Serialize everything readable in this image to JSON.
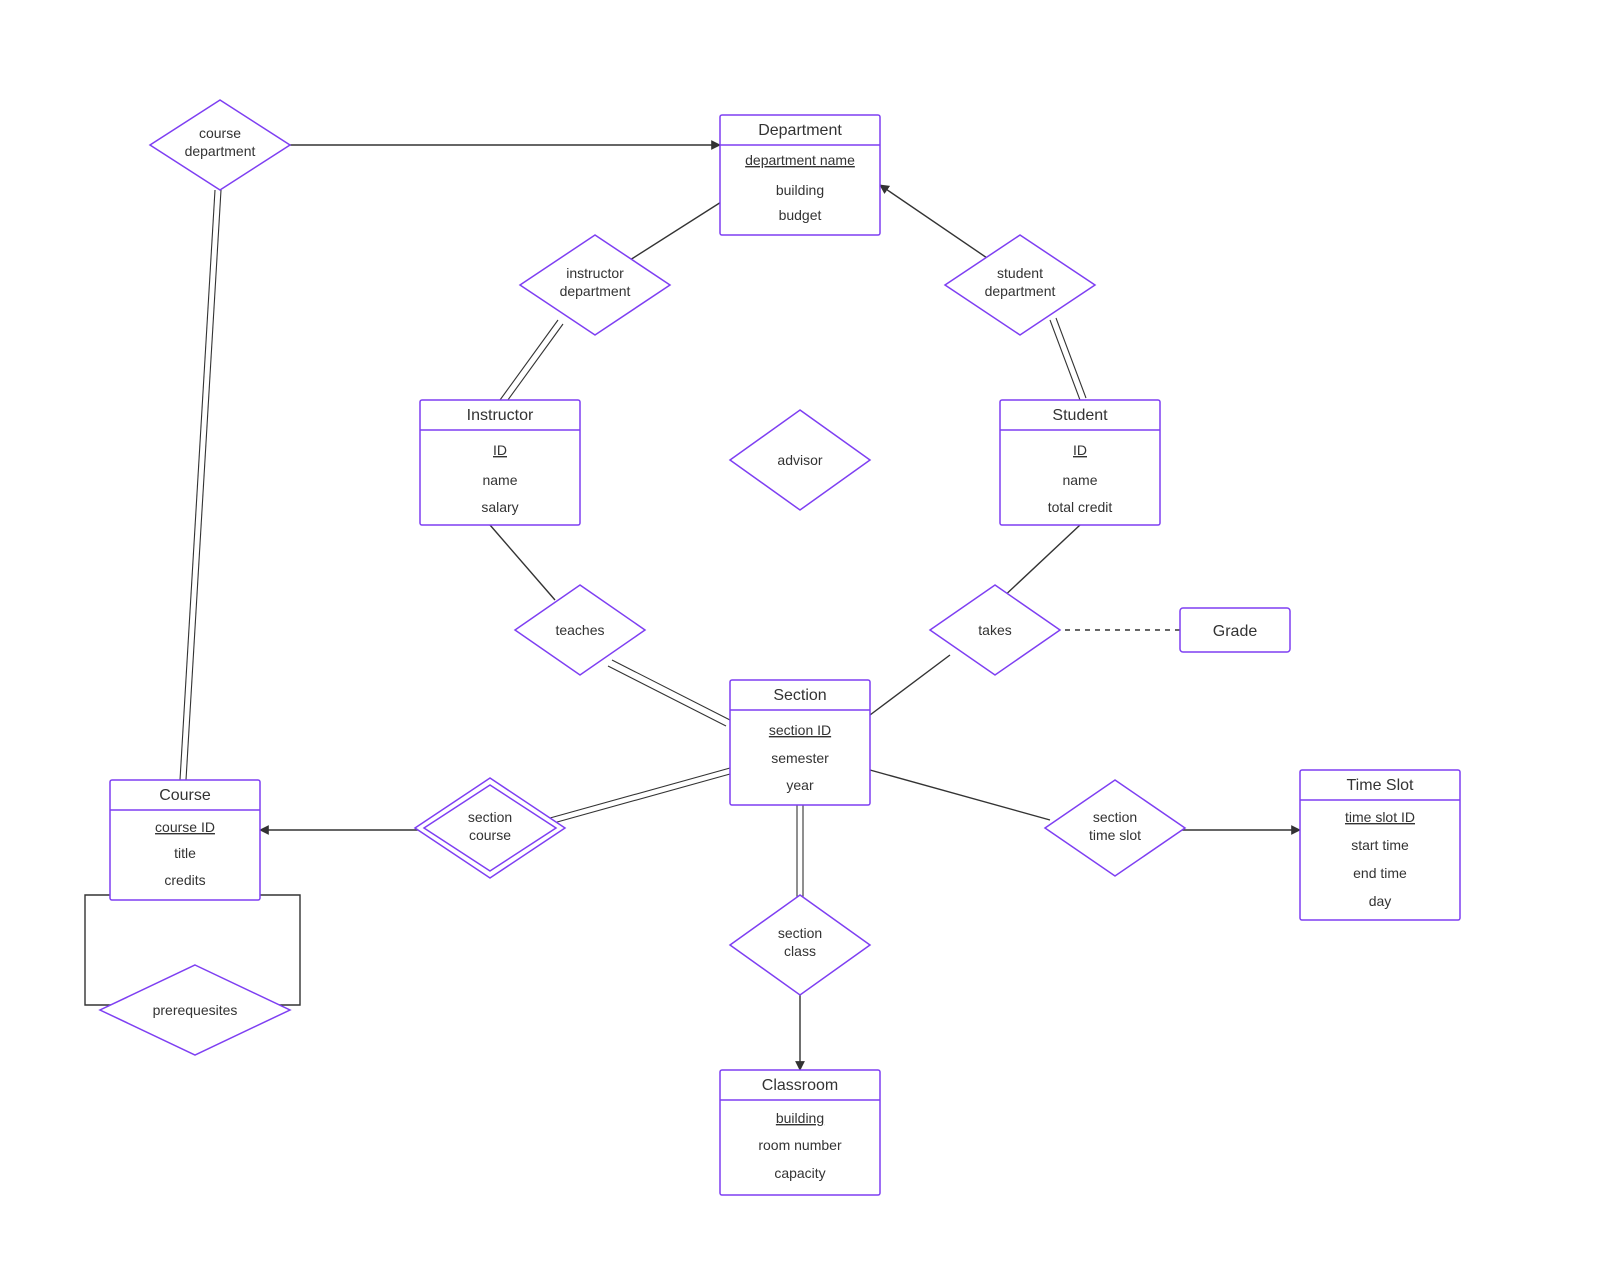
{
  "entities": {
    "department": {
      "title": "Department",
      "key": "department name",
      "a1": "building",
      "a2": "budget"
    },
    "instructor": {
      "title": "Instructor",
      "key": "ID",
      "a1": "name",
      "a2": "salary"
    },
    "student": {
      "title": "Student",
      "key": "ID",
      "a1": "name",
      "a2": "total credit"
    },
    "section": {
      "title": "Section",
      "key": "section ID",
      "a1": "semester",
      "a2": "year"
    },
    "course": {
      "title": "Course",
      "key": "course ID",
      "a1": "title",
      "a2": "credits"
    },
    "classroom": {
      "title": "Classroom",
      "key": "building",
      "a1": "room number",
      "a2": "capacity"
    },
    "timeslot": {
      "title": "Time Slot",
      "key": "time slot ID",
      "a1": "start time",
      "a2": "end time",
      "a3": "day"
    },
    "grade": {
      "title": "Grade"
    }
  },
  "relationships": {
    "course_dept": {
      "l1": "course",
      "l2": "department"
    },
    "instr_dept": {
      "l1": "instructor",
      "l2": "department"
    },
    "stud_dept": {
      "l1": "student",
      "l2": "department"
    },
    "advisor": {
      "l1": "advisor"
    },
    "teaches": {
      "l1": "teaches"
    },
    "takes": {
      "l1": "takes"
    },
    "section_course": {
      "l1": "section",
      "l2": "course"
    },
    "section_timeslot": {
      "l1": "section",
      "l2": "time slot"
    },
    "section_class": {
      "l1": "section",
      "l2": "class"
    },
    "prereq": {
      "l1": "prerequesites"
    }
  }
}
